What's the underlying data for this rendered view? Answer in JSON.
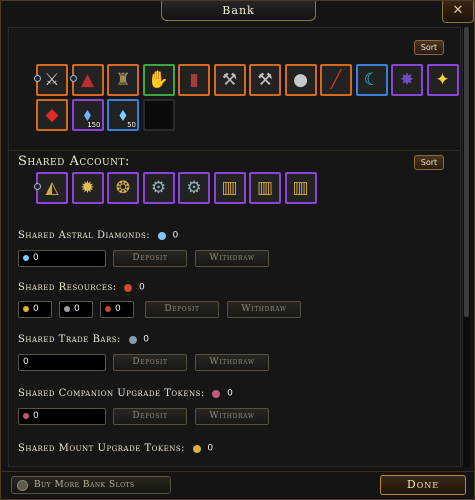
{
  "window": {
    "title": "Bank",
    "close_glyph": "✕"
  },
  "bank": {
    "sort_label": "Sort",
    "slots": [
      {
        "icon": "crossbow-icon",
        "glyph": "⚔",
        "color": "#c9c9c9",
        "rarity": "orange",
        "count": ""
      },
      {
        "icon": "hat-icon",
        "glyph": "▲",
        "color": "#b92f2f",
        "rarity": "orange",
        "count": ""
      },
      {
        "icon": "armor-icon",
        "glyph": "♜",
        "color": "#9e8b5a",
        "rarity": "orange",
        "count": ""
      },
      {
        "icon": "gloves-icon",
        "glyph": "✋",
        "color": "#3a3a3a",
        "rarity": "green",
        "count": ""
      },
      {
        "icon": "boots-icon",
        "glyph": "▮",
        "color": "#a53b3b",
        "rarity": "orange",
        "count": ""
      },
      {
        "icon": "axe-icon",
        "glyph": "⚒",
        "color": "#b9b9b9",
        "rarity": "orange",
        "count": ""
      },
      {
        "icon": "hammer-icon",
        "glyph": "⚒",
        "color": "#c4c4c4",
        "rarity": "orange",
        "count": ""
      },
      {
        "icon": "pouch-icon",
        "glyph": "●",
        "color": "#c9c9c9",
        "rarity": "orange",
        "count": ""
      },
      {
        "icon": "spear-icon",
        "glyph": "╱",
        "color": "#c63a2a",
        "rarity": "orange",
        "count": ""
      },
      {
        "icon": "horn-icon",
        "glyph": "☾",
        "color": "#2fd0d8",
        "rarity": "blue",
        "count": ""
      },
      {
        "icon": "rune-icon",
        "glyph": "✸",
        "color": "#6a4fbf",
        "rarity": "purple",
        "count": ""
      },
      {
        "icon": "star-shard-icon",
        "glyph": "✦",
        "color": "#f0d040",
        "rarity": "purple",
        "count": ""
      },
      {
        "icon": "red-gem-icon",
        "glyph": "◆",
        "color": "#e22a2a",
        "rarity": "orange",
        "count": ""
      },
      {
        "icon": "blue-crystal-icon",
        "glyph": "⬧",
        "color": "#6db4ff",
        "rarity": "purple",
        "count": "150"
      },
      {
        "icon": "blue-crystal-icon",
        "glyph": "⬧",
        "color": "#7fd0ff",
        "rarity": "blue",
        "count": "50"
      },
      {
        "icon": "",
        "glyph": "",
        "color": "#000000",
        "rarity": "empty",
        "count": ""
      }
    ]
  },
  "shared": {
    "heading": "Shared Account:",
    "sort_label": "Sort",
    "slots": [
      {
        "icon": "mask-icon",
        "glyph": "◭",
        "color": "#d4a840",
        "rarity": "purple"
      },
      {
        "icon": "sun-charm-icon",
        "glyph": "✹",
        "color": "#e0c050",
        "rarity": "purple"
      },
      {
        "icon": "amulet-icon",
        "glyph": "❂",
        "color": "#d8b454",
        "rarity": "purple"
      },
      {
        "icon": "ring-icon",
        "glyph": "⚙",
        "color": "#8fb0b4",
        "rarity": "purple"
      },
      {
        "icon": "ring-icon",
        "glyph": "⚙",
        "color": "#8fb0b4",
        "rarity": "purple"
      },
      {
        "icon": "cage-icon",
        "glyph": "▥",
        "color": "#d6a93a",
        "rarity": "purple"
      },
      {
        "icon": "cage-icon",
        "glyph": "▥",
        "color": "#d6a93a",
        "rarity": "purple"
      },
      {
        "icon": "cage-icon",
        "glyph": "▥",
        "color": "#d6a93a",
        "rarity": "purple"
      }
    ]
  },
  "currencies": {
    "astral": {
      "label": "Shared Astral Diamonds:",
      "amount": "0",
      "icon_color": "#7fc6ff",
      "field_value": "0",
      "deposit": "Deposit",
      "withdraw": "Withdraw"
    },
    "resources": {
      "label": "Shared Resources:",
      "amount": "0",
      "icon_color": "#d04a2a",
      "fields": [
        {
          "value": "0",
          "color": "#e0b030"
        },
        {
          "value": "0",
          "color": "#a0a0a0"
        },
        {
          "value": "0",
          "color": "#c04a2a"
        }
      ],
      "deposit": "Deposit",
      "withdraw": "Withdraw"
    },
    "tradebars": {
      "label": "Shared Trade Bars:",
      "amount": "0",
      "icon_color": "#8a9aa8",
      "field_value": "0",
      "deposit": "Deposit",
      "withdraw": "Withdraw"
    },
    "companion": {
      "label": "Shared Companion Upgrade Tokens:",
      "amount": "0",
      "icon_color": "#c05a78",
      "field_value": "0",
      "deposit": "Deposit",
      "withdraw": "Withdraw"
    },
    "mount": {
      "label": "Shared Mount Upgrade Tokens:",
      "amount": "0",
      "icon_color": "#d8b040"
    }
  },
  "footer": {
    "buy_label": "Buy More Bank Slots",
    "done_label": "Done"
  }
}
